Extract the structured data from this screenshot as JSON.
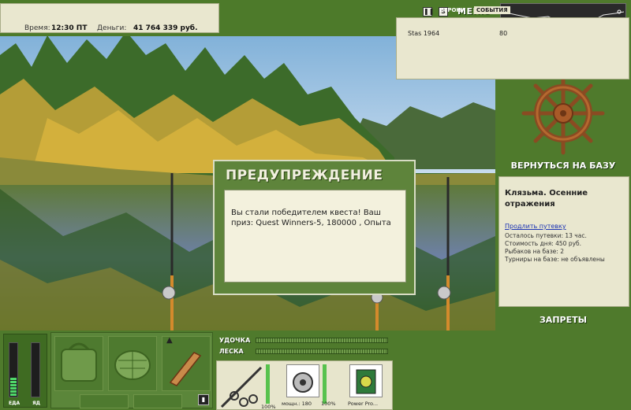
{
  "header": {
    "time_label": "Время:",
    "time_value": "12:30 ПТ",
    "money_label": "Деньги:",
    "money_value": "41 764 339 руб.",
    "pause_icon": "pause-icon",
    "sound_label": "S",
    "menu_label": "МЕНЮ"
  },
  "dialog": {
    "title": "ПРЕДУПРЕЖДЕНИЕ",
    "message": "Вы стали победителем квеста! Ваш приз: Quest Winners-5, 180000 , Опыта"
  },
  "depth": {
    "value": "0 m"
  },
  "right": {
    "return_label": "ВЕРНУТЬСЯ НА БАЗУ",
    "base_title": "Клязьма. Осенние отражения",
    "extend_link": "Продлить путевку",
    "time_left": "Осталось путевки: 13 час.",
    "day_cost": "Стоимость дня: 450 руб.",
    "anglers": "Рыбаков на базе: 2",
    "tournaments": "Турниры на базе: не объявлены",
    "bans_label": "ЗАПРЕТЫ"
  },
  "meters": {
    "food_label": "ЕДА",
    "food_level": 0.35,
    "poison_label": "ЯД",
    "poison_level": 0
  },
  "tackle": {
    "rod_label": "УДОЧКА",
    "line_label": "ЛЕСКА",
    "rod_percent": "100%",
    "reel_text": "мощн.: 180",
    "reel_percent": "100%",
    "bait_text": "Power Pro...",
    "rod_level": 1,
    "reel_level": 1
  },
  "chat": {
    "tab_players": "ИГРОКИ",
    "tab_events": "СОБЫТИЯ",
    "rows": [
      {
        "name": "Stas 1964",
        "score": "80"
      }
    ]
  },
  "colors": {
    "panel_green": "#4f7a2c",
    "panel_beige": "#e9e7cf",
    "link_blue": "#1b33b3"
  }
}
